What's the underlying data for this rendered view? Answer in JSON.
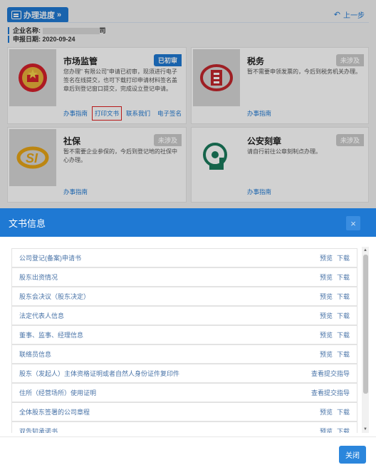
{
  "header": {
    "tab_label": "办理进度",
    "tab_chevron": "»",
    "back_label": "上一步"
  },
  "info": {
    "company_label": "企业名称:",
    "company_value_masked": "",
    "company_value_suffix": "司",
    "date_label": "申报日期:",
    "date_value": "2020-09-24"
  },
  "cards": [
    {
      "title": "市场监管",
      "badge": "已初审",
      "desc": "您办理\"                       有限公司\"申请已初审，现须进行电子签名在线提交，也可下载打印申请材料签名盖章后到登记窗口提交，完成设立登记申请。",
      "links": [
        "办事指南",
        "打印文书",
        "联系我们",
        "电子签名"
      ]
    },
    {
      "title": "税务",
      "badge": "未涉及",
      "desc": "暂不需要申领发票的，今后到税务机关办理。",
      "links": [
        "办事指南"
      ]
    },
    {
      "title": "社保",
      "badge": "未涉及",
      "desc": "暂不需要企业参保的，今后到登记地的社保中心办理。",
      "links": [
        "办事指南"
      ]
    },
    {
      "title": "公安刻章",
      "badge": "未涉及",
      "desc": "请自行前往公章刻制点办理。",
      "links": [
        "办事指南"
      ]
    }
  ],
  "modal": {
    "title": "文书信息",
    "close_icon": "×",
    "close_button": "关闭",
    "docs": [
      {
        "name": "公司登记(备案)申请书",
        "actions": [
          "预览",
          "下载"
        ]
      },
      {
        "name": "股东出资情况",
        "actions": [
          "预览",
          "下载"
        ]
      },
      {
        "name": "股东会决议（股东决定）",
        "actions": [
          "预览",
          "下载"
        ]
      },
      {
        "name": "法定代表人信息",
        "actions": [
          "预览",
          "下载"
        ]
      },
      {
        "name": "董事、监事、经理信息",
        "actions": [
          "预览",
          "下载"
        ]
      },
      {
        "name": "联络员信息",
        "actions": [
          "预览",
          "下载"
        ]
      },
      {
        "name": "股东（发起人）主体资格证明或者自然人身份证件复印件",
        "actions": [
          "查看提交指导"
        ]
      },
      {
        "name": "住所（经营场所）使用证明",
        "actions": [
          "查看提交指导"
        ]
      },
      {
        "name": "全体股东签署的公司章程",
        "actions": [
          "预览",
          "下载"
        ]
      },
      {
        "name": "双告知承诺书",
        "actions": [
          "预览",
          "下载"
        ]
      }
    ]
  },
  "colors": {
    "primary": "#1f79d3",
    "link": "#4a74a8",
    "highlight": "#e02020"
  }
}
